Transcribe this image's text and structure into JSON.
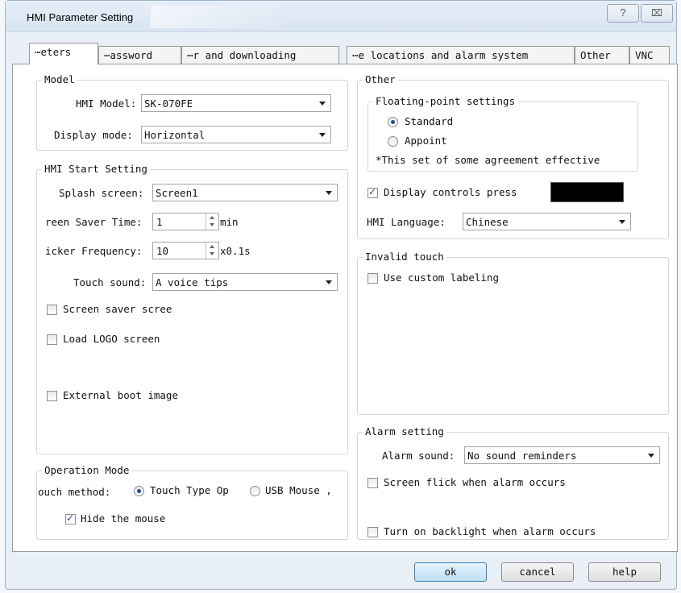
{
  "window": {
    "title": "HMI Parameter Setting",
    "help_glyph": "?",
    "close_glyph": "⌥"
  },
  "tabs": [
    {
      "label": "⋯eters",
      "active": true
    },
    {
      "label": "⋯assword",
      "active": false
    },
    {
      "label": "⋯r and downloading",
      "active": false
    },
    {
      "label": "⋯e locations and alarm system",
      "active": false
    },
    {
      "label": "Other",
      "active": false
    },
    {
      "label": "VNC",
      "active": false
    }
  ],
  "model": {
    "title": "Model",
    "hmi_model_label": "HMI Model:",
    "hmi_model_value": "SK-070FE",
    "display_mode_label": "Display mode:",
    "display_mode_value": "Horizontal"
  },
  "start": {
    "title": "HMI Start Setting",
    "splash_label": "Splash screen:",
    "splash_value": "Screen1",
    "saver_time_label": "reen Saver Time:",
    "saver_time_value": "1",
    "saver_time_unit": "min",
    "flicker_label": "icker Frequency:",
    "flicker_value": "10",
    "flicker_unit": "x0.1s",
    "touch_sound_label": "Touch sound:",
    "touch_sound_value": "A voice tips",
    "screen_saver_label": "Screen saver scree",
    "screen_saver_checked": false,
    "load_logo_label": "Load LOGO screen",
    "load_logo_checked": false,
    "external_boot_label": "External boot image",
    "external_boot_checked": false
  },
  "operation": {
    "title": "Operation Mode",
    "touch_method_label": "ouch method:",
    "touch_type_label": "Touch Type Op",
    "touch_type_selected": true,
    "usb_mouse_label": "USB Mouse ,",
    "usb_mouse_selected": false,
    "hide_mouse_label": "Hide the mouse",
    "hide_mouse_checked": true
  },
  "other": {
    "title": "Other",
    "float_title": "Floating-point settings",
    "standard_label": "Standard",
    "standard_selected": true,
    "appoint_label": "Appoint",
    "appoint_selected": false,
    "note": "*This set of some agreement effective",
    "display_press_label": "Display controls press",
    "display_press_checked": true,
    "press_color": "#000000",
    "language_label": "HMI Language:",
    "language_value": "Chinese"
  },
  "invalid_touch": {
    "title": "Invalid touch",
    "custom_label": "Use custom labeling",
    "custom_checked": false
  },
  "alarm": {
    "title": "Alarm setting",
    "sound_label": "Alarm sound:",
    "sound_value": "No sound reminders",
    "flick_label": "Screen flick when alarm occurs",
    "flick_checked": false,
    "backlight_label": "Turn on backlight when alarm occurs",
    "backlight_checked": false
  },
  "buttons": {
    "ok": "ok",
    "cancel": "cancel",
    "help": "help"
  }
}
